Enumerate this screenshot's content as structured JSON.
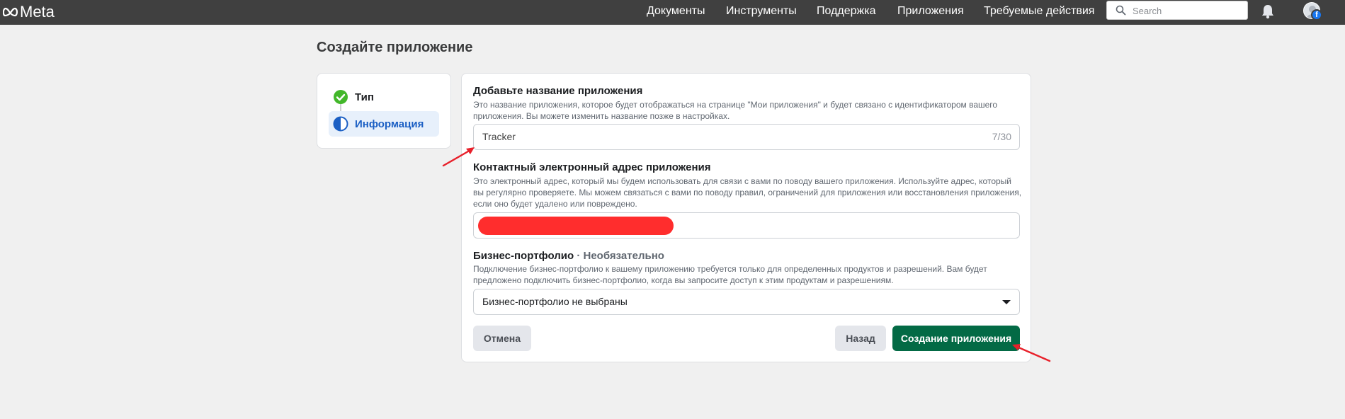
{
  "topbar": {
    "logo_text": "Meta",
    "nav": [
      "Документы",
      "Инструменты",
      "Поддержка",
      "Приложения",
      "Требуемые действия"
    ],
    "search_placeholder": "Search",
    "icons": [
      "search-icon",
      "bell-icon",
      "avatar",
      "facebook-badge-icon"
    ]
  },
  "page": {
    "title": "Создайте приложение"
  },
  "steps": [
    {
      "label": "Тип",
      "status": "complete"
    },
    {
      "label": "Информация",
      "status": "in-progress"
    }
  ],
  "form": {
    "app_name": {
      "label": "Добавьте название приложения",
      "help": "Это название приложения, которое будет отображаться на странице \"Мои приложения\" и будет связано с идентификатором вашего приложения. Вы можете изменить название позже в настройках.",
      "value": "Tracker",
      "counter": "7/30"
    },
    "contact_email": {
      "label": "Контактный электронный адрес приложения",
      "help": "Это электронный адрес, который мы будем использовать для связи с вами по поводу вашего приложения. Используйте адрес, который вы регулярно проверяете. Мы можем связаться с вами по поводу правил, ограничений для приложения или восстановления приложения, если оно будет удалено или повреждено.",
      "value_redacted": true
    },
    "business_portfolio": {
      "label": "Бизнес-портфолио",
      "optional_suffix": "· Необязательно",
      "help": "Подключение бизнес-портфолио к вашему приложению требуется только для определенных продуктов и разрешений. Вам будет предложено подключить бизнес-портфолио, когда вы запросите доступ к этим продуктам и разрешениям.",
      "selected": "Бизнес-портфолио не выбраны"
    },
    "buttons": {
      "cancel": "Отмена",
      "back": "Назад",
      "create": "Создание приложения"
    }
  },
  "colors": {
    "topbar": "#404040",
    "primary_button": "#036a45",
    "active_step_bg": "#e7f0fb",
    "active_step_text": "#1b5fc4",
    "check_green": "#42b72a",
    "annotation_arrow": "#e8202a",
    "redaction": "#ff2d2d"
  }
}
